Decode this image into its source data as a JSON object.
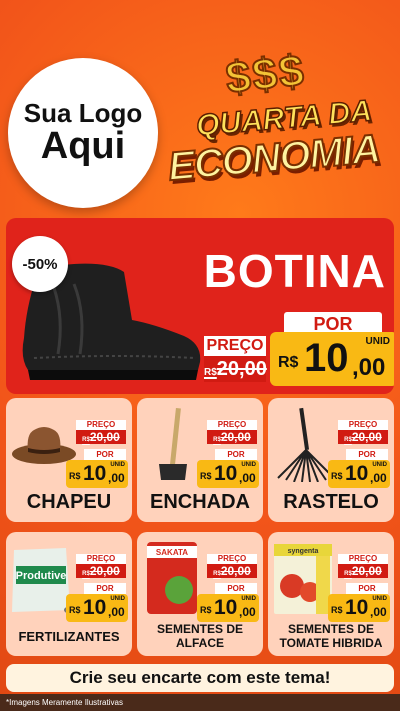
{
  "logo": {
    "line1": "Sua Logo",
    "line2": "Aqui"
  },
  "title": {
    "symbols": "$$$",
    "line1": "QUARTA DA",
    "line2": "ECONOMIA"
  },
  "hero": {
    "discount": "-50%",
    "name": "BOTINA",
    "preco_label": "PREÇO",
    "old_currency": "R$",
    "old_price": "20,00",
    "por_label": "POR",
    "currency": "R$",
    "price_int": "10",
    "price_dec": ",00",
    "unit": "UNID"
  },
  "products": [
    {
      "name": "CHAPEU",
      "preco_label": "PREÇO",
      "old_currency": "R$",
      "old_price": "20,00",
      "por_label": "POR",
      "currency": "R$",
      "price_int": "10",
      "price_dec": ",00",
      "unit": "UNID"
    },
    {
      "name": "ENCHADA",
      "preco_label": "PREÇO",
      "old_currency": "R$",
      "old_price": "20,00",
      "por_label": "POR",
      "currency": "R$",
      "price_int": "10",
      "price_dec": ",00",
      "unit": "UNID"
    },
    {
      "name": "RASTELO",
      "preco_label": "PREÇO",
      "old_currency": "R$",
      "old_price": "20,00",
      "por_label": "POR",
      "currency": "R$",
      "price_int": "10",
      "price_dec": ",00",
      "unit": "UNID"
    },
    {
      "name": "FERTILIZANTES",
      "brand": "Produtive",
      "preco_label": "PREÇO",
      "old_currency": "R$",
      "old_price": "20,00",
      "por_label": "POR",
      "currency": "R$",
      "price_int": "10",
      "price_dec": ",00",
      "unit": "UNID"
    },
    {
      "name_line1": "SEMENTES DE",
      "name_line2": "ALFACE",
      "brand": "SAKATA",
      "preco_label": "PREÇO",
      "old_currency": "R$",
      "old_price": "20,00",
      "por_label": "POR",
      "currency": "R$",
      "price_int": "10",
      "price_dec": ",00",
      "unit": "UNID"
    },
    {
      "name_line1": "SEMENTES DE",
      "name_line2": "TOMATE HIBRIDA",
      "brand": "syngenta",
      "preco_label": "PREÇO",
      "old_currency": "R$",
      "old_price": "20,00",
      "por_label": "POR",
      "currency": "R$",
      "price_int": "10",
      "price_dec": ",00",
      "unit": "UNID"
    }
  ],
  "cta": "Crie seu encarte com este tema!",
  "footer": "*Imagens Meramente Ilustrativas",
  "colors": {
    "accent_red": "#e0231b",
    "price_yellow": "#f9b914",
    "card_bg": "#ffd2bb",
    "bg_orange": "#f2551a"
  }
}
